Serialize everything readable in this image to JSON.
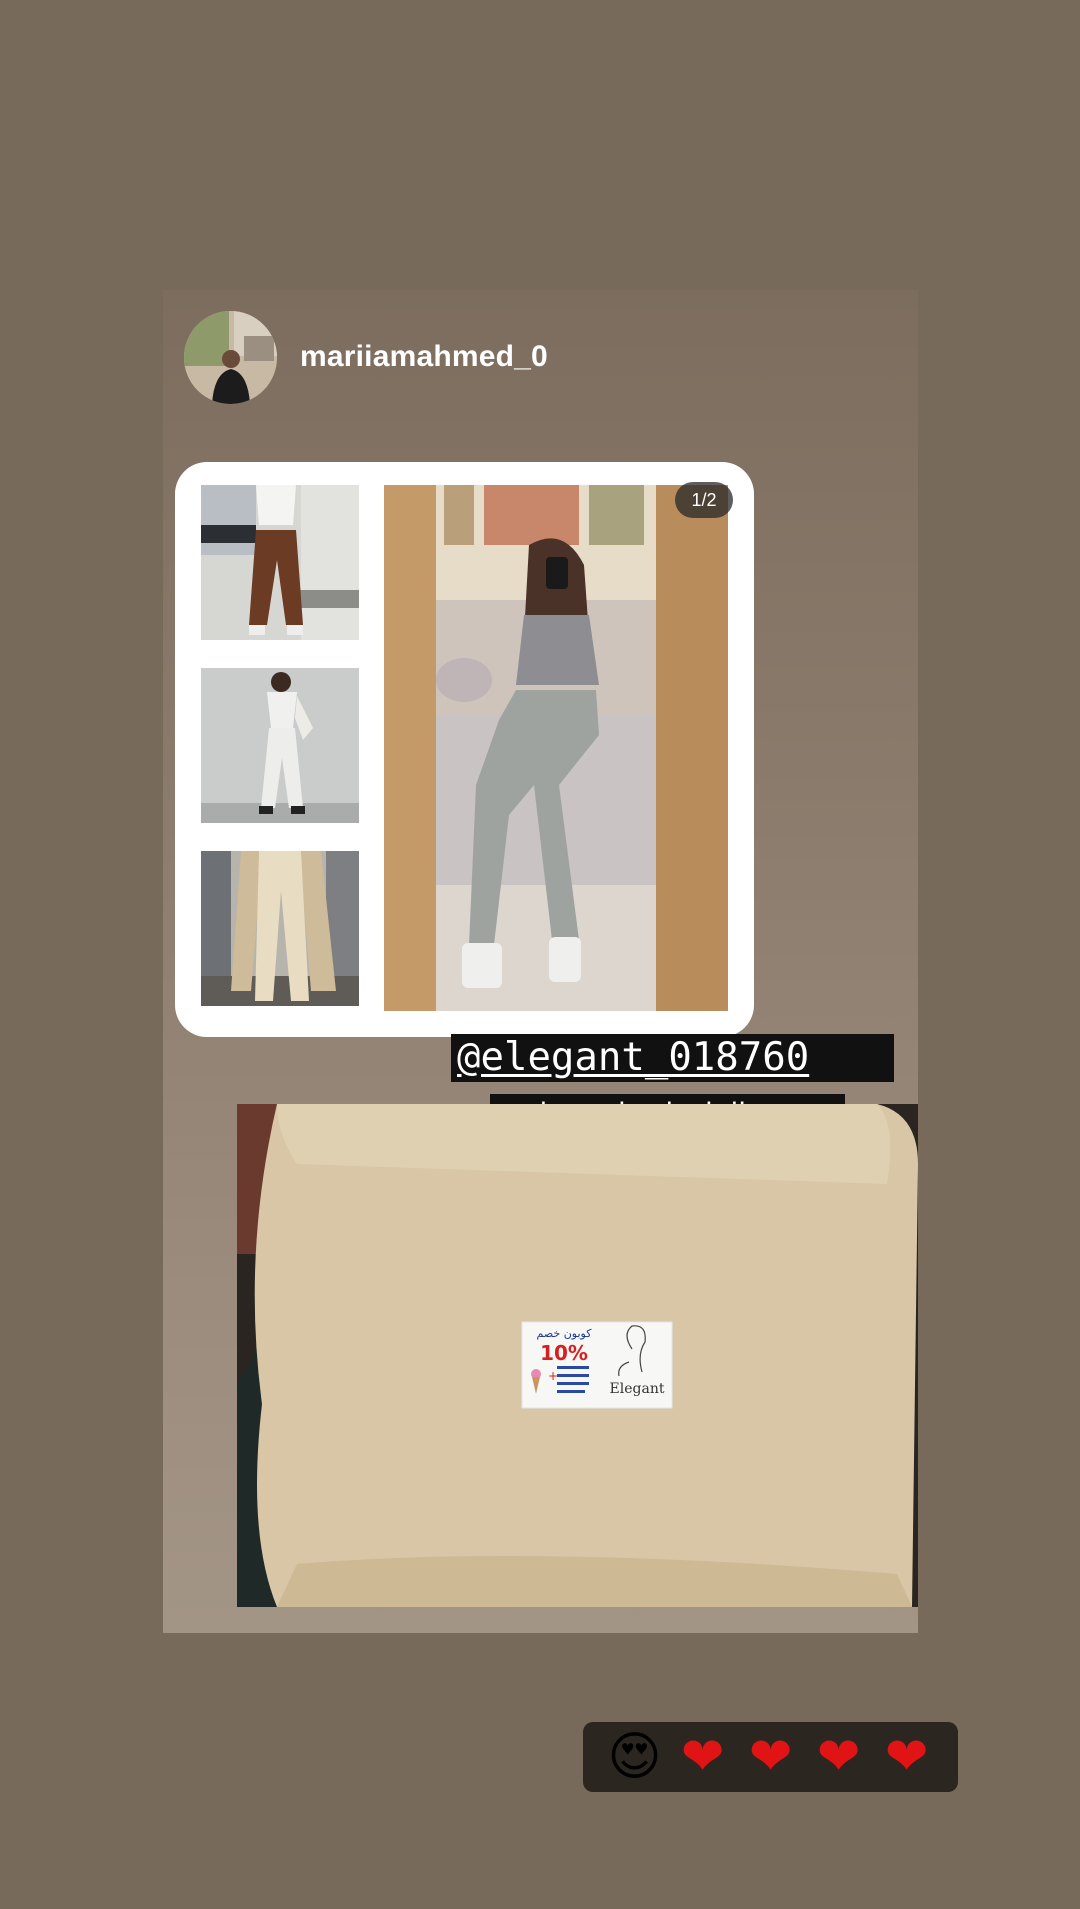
{
  "story": {
    "username": "mariiamahmed_0",
    "page_indicator": "1/2",
    "mention": "@elegant_018760",
    "caption": "بجد الماتريل حلوة جدا",
    "coupon": {
      "title": "كوبون خصم",
      "discount": "10%",
      "brand": "Elegant"
    }
  },
  "reactions": {
    "emojis": [
      "😍",
      "❤",
      "❤",
      "❤",
      "❤"
    ]
  },
  "colors": {
    "background": "#786a5b",
    "card": "#8f7f70",
    "label_bg": "#111111",
    "heart": "#e01414"
  }
}
